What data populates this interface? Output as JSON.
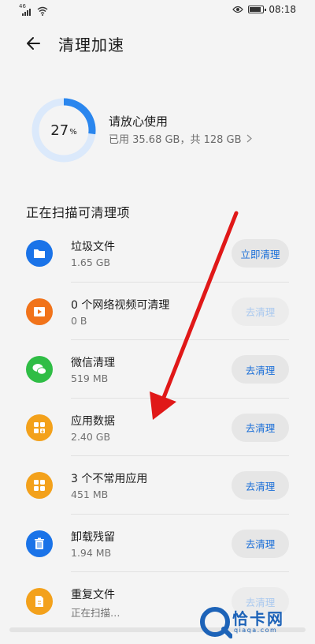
{
  "status_bar": {
    "network": "46",
    "time": "08:18",
    "battery_level": 0.85
  },
  "header": {
    "title": "清理加速"
  },
  "storage": {
    "percent_value": "27",
    "percent_sign": "%",
    "used_fraction": 0.27,
    "title": "请放心使用",
    "detail": "已用 35.68 GB，共 128 GB"
  },
  "section_title": "正在扫描可清理项",
  "items": [
    {
      "name": "垃圾文件",
      "size": "1.65 GB",
      "button": "立即清理",
      "icon": "folder-icon",
      "color": "#1a73e8",
      "enabled": true
    },
    {
      "name": "0 个网络视频可清理",
      "size": "0 B",
      "button": "去清理",
      "icon": "video-icon",
      "color": "#f1731a",
      "enabled": false
    },
    {
      "name": "微信清理",
      "size": "519 MB",
      "button": "去清理",
      "icon": "wechat-icon",
      "color": "#2fbd45",
      "enabled": true
    },
    {
      "name": "应用数据",
      "size": "2.40 GB",
      "button": "去清理",
      "icon": "app-data-icon",
      "color": "#f3a11b",
      "enabled": true
    },
    {
      "name": "3 个不常用应用",
      "size": "451 MB",
      "button": "去清理",
      "icon": "apps-grid-icon",
      "color": "#f3a11b",
      "enabled": true
    },
    {
      "name": "卸载残留",
      "size": "1.94 MB",
      "button": "去清理",
      "icon": "trash-icon",
      "color": "#1a73e8",
      "enabled": true
    },
    {
      "name": "重复文件",
      "size": "正在扫描…",
      "button": "去清理",
      "icon": "duplicate-file-icon",
      "color": "#f3a11b",
      "enabled": false
    }
  ],
  "watermark": {
    "text": "恰卡网",
    "url": "qiaqa.com"
  },
  "colors": {
    "accent": "#1a73e8",
    "annotation_arrow": "#e01818"
  }
}
